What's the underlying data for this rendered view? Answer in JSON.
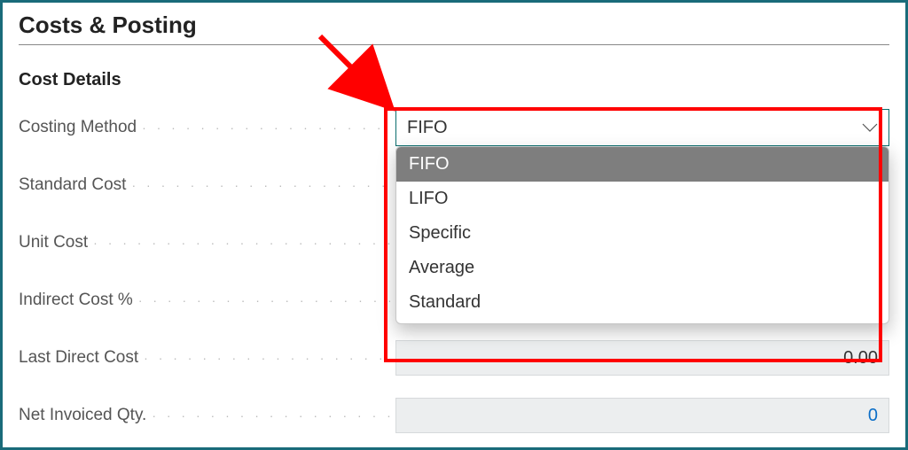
{
  "section_title": "Costs & Posting",
  "subsection_title": "Cost Details",
  "fields": {
    "costing_method": {
      "label": "Costing Method",
      "value": "FIFO"
    },
    "standard_cost": {
      "label": "Standard Cost"
    },
    "unit_cost": {
      "label": "Unit Cost"
    },
    "indirect_cost": {
      "label": "Indirect Cost %"
    },
    "last_direct": {
      "label": "Last Direct Cost",
      "value": "0.00"
    },
    "net_invoiced": {
      "label": "Net Invoiced Qty.",
      "value": "0"
    }
  },
  "costing_method_options": [
    "FIFO",
    "LIFO",
    "Specific",
    "Average",
    "Standard"
  ],
  "dots": "· · · · · · · · · · · · · · · · · · · · · · · · · · · · · · · · · · · · · ·"
}
